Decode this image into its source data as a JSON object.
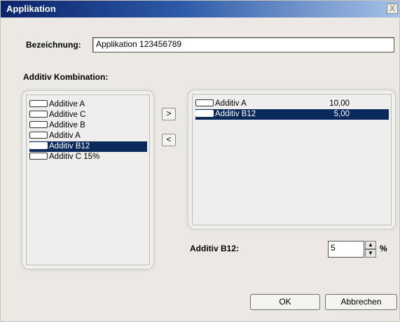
{
  "window": {
    "title": "Applikation",
    "close_glyph": "X"
  },
  "name": {
    "label": "Bezeichnung:",
    "value": "Applikation 123456789"
  },
  "additive_section_label": "Additiv Kombination:",
  "available_list": [
    {
      "label": "Additive A",
      "selected": false
    },
    {
      "label": "Additive C",
      "selected": false
    },
    {
      "label": "Additive B",
      "selected": false
    },
    {
      "label": "Additiv A",
      "selected": false
    },
    {
      "label": "Additiv B12",
      "selected": true
    },
    {
      "label": "Additiv C 15%",
      "selected": false
    }
  ],
  "transfer": {
    "add_label": ">",
    "remove_label": "<"
  },
  "selected_list": [
    {
      "label": "Additiv A",
      "value": "10,00",
      "selected": false
    },
    {
      "label": "Additiv B12",
      "value": "5,00",
      "selected": true
    }
  ],
  "amount": {
    "label": "Additiv B12:",
    "value": "5",
    "unit": "%",
    "up_glyph": "▲",
    "down_glyph": "▼"
  },
  "buttons": {
    "ok": "OK",
    "cancel": "Abbrechen"
  }
}
